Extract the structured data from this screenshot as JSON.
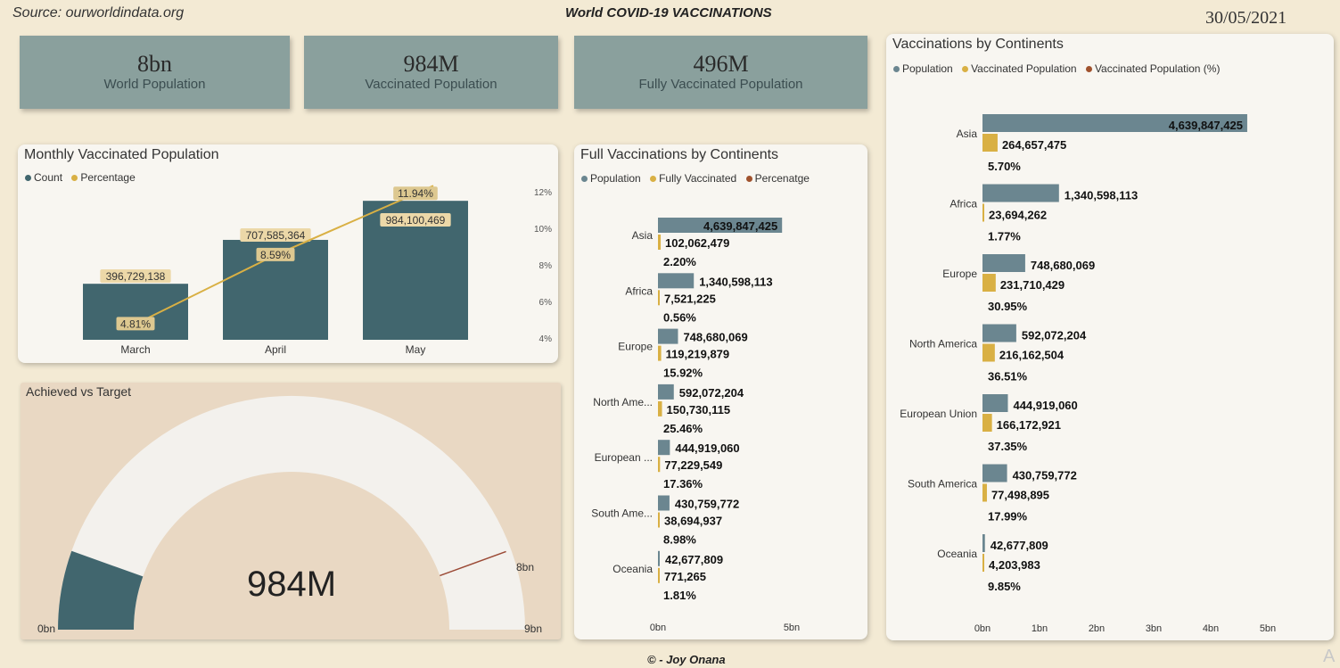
{
  "header": {
    "source": "Source: ourworldindata.org",
    "title": "World COVID-19 VACCINATIONS",
    "date": "30/05/2021",
    "footer": "© - Joy Onana"
  },
  "kpis": [
    {
      "value": "8bn",
      "label": "World Population"
    },
    {
      "value": "984M",
      "label": "Vaccinated Population"
    },
    {
      "value": "496M",
      "label": "Fully Vaccinated Population"
    }
  ],
  "colors": {
    "teal": "#41666e",
    "slate": "#6b8690",
    "gold": "#d9b044",
    "rust": "#a0522d",
    "kpi_bg": "#8aa09d"
  },
  "monthly": {
    "title": "Monthly Vaccinated Population",
    "legend": [
      "Count",
      "Percentage"
    ]
  },
  "full_vacc": {
    "title": "Full Vaccinations by Continents",
    "legend": [
      "Population",
      "Fully Vaccinated",
      "Percenatge"
    ]
  },
  "vacc_cont": {
    "title": "Vaccinations by Continents",
    "legend": [
      "Population",
      "Vaccinated Population",
      "Vaccinated Population (%)"
    ]
  },
  "gauge": {
    "title": "Achieved vs Target",
    "value_label": "984M",
    "min_label": "0bn",
    "max_label": "9bn",
    "target_label": "8bn",
    "value": 0.984,
    "min": 0,
    "max": 9,
    "target": 8
  },
  "chart_data": [
    {
      "type": "bar",
      "title": "Monthly Vaccinated Population",
      "categories": [
        "March",
        "April",
        "May"
      ],
      "series": [
        {
          "name": "Count",
          "values": [
            396729138,
            707585364,
            984100469
          ],
          "labels": [
            "396,729,138",
            "707,585,364",
            "984,100,469"
          ]
        },
        {
          "name": "Percentage",
          "values": [
            4.81,
            8.59,
            11.94
          ],
          "labels": [
            "4.81%",
            "8.59%",
            "11.94%"
          ]
        }
      ],
      "y2_ticks": [
        "4%",
        "6%",
        "8%",
        "10%",
        "12%"
      ],
      "y2lim": [
        4,
        12
      ],
      "ylim": [
        0,
        1200000000
      ]
    },
    {
      "type": "bar",
      "title": "Full Vaccinations by Continents",
      "categories": [
        "Asia",
        "Africa",
        "Europe",
        "North Ame...",
        "European ...",
        "South Ame...",
        "Oceania"
      ],
      "series": [
        {
          "name": "Population",
          "values": [
            4639847425,
            1340598113,
            748680069,
            592072204,
            444919060,
            430759772,
            42677809
          ],
          "labels": [
            "4,639,847,425",
            "1,340,598,113",
            "748,680,069",
            "592,072,204",
            "444,919,060",
            "430,759,772",
            "42,677,809"
          ]
        },
        {
          "name": "Fully Vaccinated",
          "values": [
            102062479,
            7521225,
            119219879,
            150730115,
            77229549,
            38694937,
            771265
          ],
          "labels": [
            "102,062,479",
            "7,521,225",
            "119,219,879",
            "150,730,115",
            "77,229,549",
            "38,694,937",
            "771,265"
          ]
        },
        {
          "name": "Percenatge",
          "values": [
            2.2,
            0.56,
            15.92,
            25.46,
            17.36,
            8.98,
            1.81
          ],
          "labels": [
            "2.20%",
            "0.56%",
            "15.92%",
            "25.46%",
            "17.36%",
            "8.98%",
            "1.81%"
          ]
        }
      ],
      "x_ticks": [
        "0bn",
        "5bn"
      ],
      "xlim": [
        0,
        5000000000
      ]
    },
    {
      "type": "bar",
      "title": "Vaccinations by Continents",
      "categories": [
        "Asia",
        "Africa",
        "Europe",
        "North America",
        "European Union",
        "South America",
        "Oceania"
      ],
      "series": [
        {
          "name": "Population",
          "values": [
            4639847425,
            1340598113,
            748680069,
            592072204,
            444919060,
            430759772,
            42677809
          ],
          "labels": [
            "4,639,847,425",
            "1,340,598,113",
            "748,680,069",
            "592,072,204",
            "444,919,060",
            "430,759,772",
            "42,677,809"
          ]
        },
        {
          "name": "Vaccinated Population",
          "values": [
            264657475,
            23694262,
            231710429,
            216162504,
            166172921,
            77498895,
            4203983
          ],
          "labels": [
            "264,657,475",
            "23,694,262",
            "231,710,429",
            "216,162,504",
            "166,172,921",
            "77,498,895",
            "4,203,983"
          ]
        },
        {
          "name": "Vaccinated Population (%)",
          "values": [
            5.7,
            1.77,
            30.95,
            36.51,
            37.35,
            17.99,
            9.85
          ],
          "labels": [
            "5.70%",
            "1.77%",
            "30.95%",
            "36.51%",
            "37.35%",
            "17.99%",
            "9.85%"
          ]
        }
      ],
      "x_ticks": [
        "0bn",
        "1bn",
        "2bn",
        "3bn",
        "4bn",
        "5bn"
      ],
      "xlim": [
        0,
        5000000000
      ]
    }
  ]
}
